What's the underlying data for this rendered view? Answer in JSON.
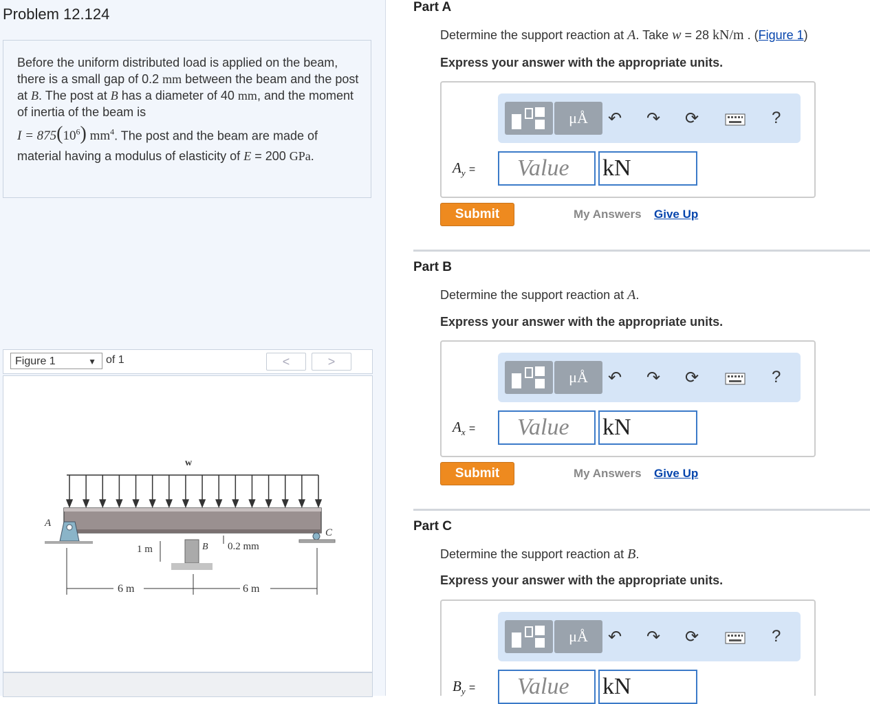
{
  "problem": {
    "title": "Problem 12.124",
    "text1": "Before the uniform distributed load is applied on the beam, there is a small gap of 0.2",
    "mm1": "mm",
    "text2": "between the beam and the post at",
    "B": "B",
    "text3": ". The post at",
    "text4": "has a diameter of 40",
    "mm2": "mm",
    "text5": ", and the moment of inertia of the beam is",
    "I_expr": "I = 875",
    "ten": "10",
    "six": "6",
    "mm4": "mm",
    "four": "4",
    "text6": ". The post and the beam are made of material having a modulus of elasticity of",
    "E": "E",
    "eq": "=",
    "text7": "200",
    "gpa": "GPa",
    "period": "."
  },
  "figure_nav": {
    "selected": "Figure 1",
    "arrow": "▼",
    "of": "of 1",
    "prev": "<",
    "next": ">"
  },
  "figure": {
    "load_label": "w",
    "A": "A",
    "C": "C",
    "B_label": "B",
    "gap_label": "0.2 mm",
    "post_label": "1 m",
    "span1": "6 m",
    "span2": "6 m"
  },
  "parts": [
    {
      "title": "Part A",
      "q_prefix": "Determine the support reaction at",
      "q_point": "A",
      "q_take": ". Take",
      "q_w": "w",
      "q_eq": " = 28",
      "q_unit": "kN/m",
      "q_dot": ".",
      "q_fig_open": "(",
      "q_fig_link": "Figure 1",
      "q_fig_close": ")",
      "express": "Express your answer with the appropriate units.",
      "label": "A",
      "sub": "y",
      "eqsign": "=",
      "value_placeholder": "Value",
      "unit": "kN",
      "submit": "Submit",
      "my_answers": "My Answers",
      "give_up": "Give Up"
    },
    {
      "title": "Part B",
      "q_prefix": "Determine the support reaction at",
      "q_point": "A",
      "q_end": ".",
      "express": "Express your answer with the appropriate units.",
      "label": "A",
      "sub": "x",
      "eqsign": "=",
      "value_placeholder": "Value",
      "unit": "kN",
      "submit": "Submit",
      "my_answers": "My Answers",
      "give_up": "Give Up"
    },
    {
      "title": "Part C",
      "q_prefix": "Determine the support reaction at",
      "q_point": "B",
      "q_end": ".",
      "express": "Express your answer with the appropriate units.",
      "label": "B",
      "sub": "y",
      "eqsign": "=",
      "value_placeholder": "Value",
      "unit": "kN"
    }
  ],
  "toolbar": {
    "mu_label": "μÅ",
    "help": "?",
    "icons": [
      "templates-icon",
      "units-icon",
      "undo-icon",
      "redo-icon",
      "reset-icon",
      "keyboard-icon",
      "help-icon"
    ]
  },
  "colors": {
    "submit": "#ee8a1f",
    "toolbar_bg": "#d6e5f7",
    "input_border": "#3b7ac8",
    "link": "#0645ad"
  }
}
